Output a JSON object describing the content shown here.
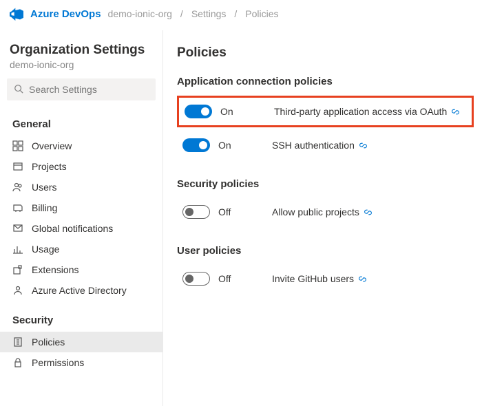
{
  "header": {
    "brand": "Azure DevOps",
    "crumbs": [
      "demo-ionic-org",
      "Settings",
      "Policies"
    ]
  },
  "sidebar": {
    "title": "Organization Settings",
    "subtitle": "demo-ionic-org",
    "search_placeholder": "Search Settings",
    "sections": {
      "general": {
        "label": "General",
        "items": [
          "Overview",
          "Projects",
          "Users",
          "Billing",
          "Global notifications",
          "Usage",
          "Extensions",
          "Azure Active Directory"
        ]
      },
      "security": {
        "label": "Security",
        "items": [
          "Policies",
          "Permissions"
        ]
      }
    }
  },
  "main": {
    "title": "Policies",
    "groups": {
      "app_conn": {
        "label": "Application connection policies",
        "rows": [
          {
            "state": "On",
            "label": "Third-party application access via OAuth"
          },
          {
            "state": "On",
            "label": "SSH authentication"
          }
        ]
      },
      "security": {
        "label": "Security policies",
        "rows": [
          {
            "state": "Off",
            "label": "Allow public projects"
          }
        ]
      },
      "user": {
        "label": "User policies",
        "rows": [
          {
            "state": "Off",
            "label": "Invite GitHub users"
          }
        ]
      }
    }
  }
}
